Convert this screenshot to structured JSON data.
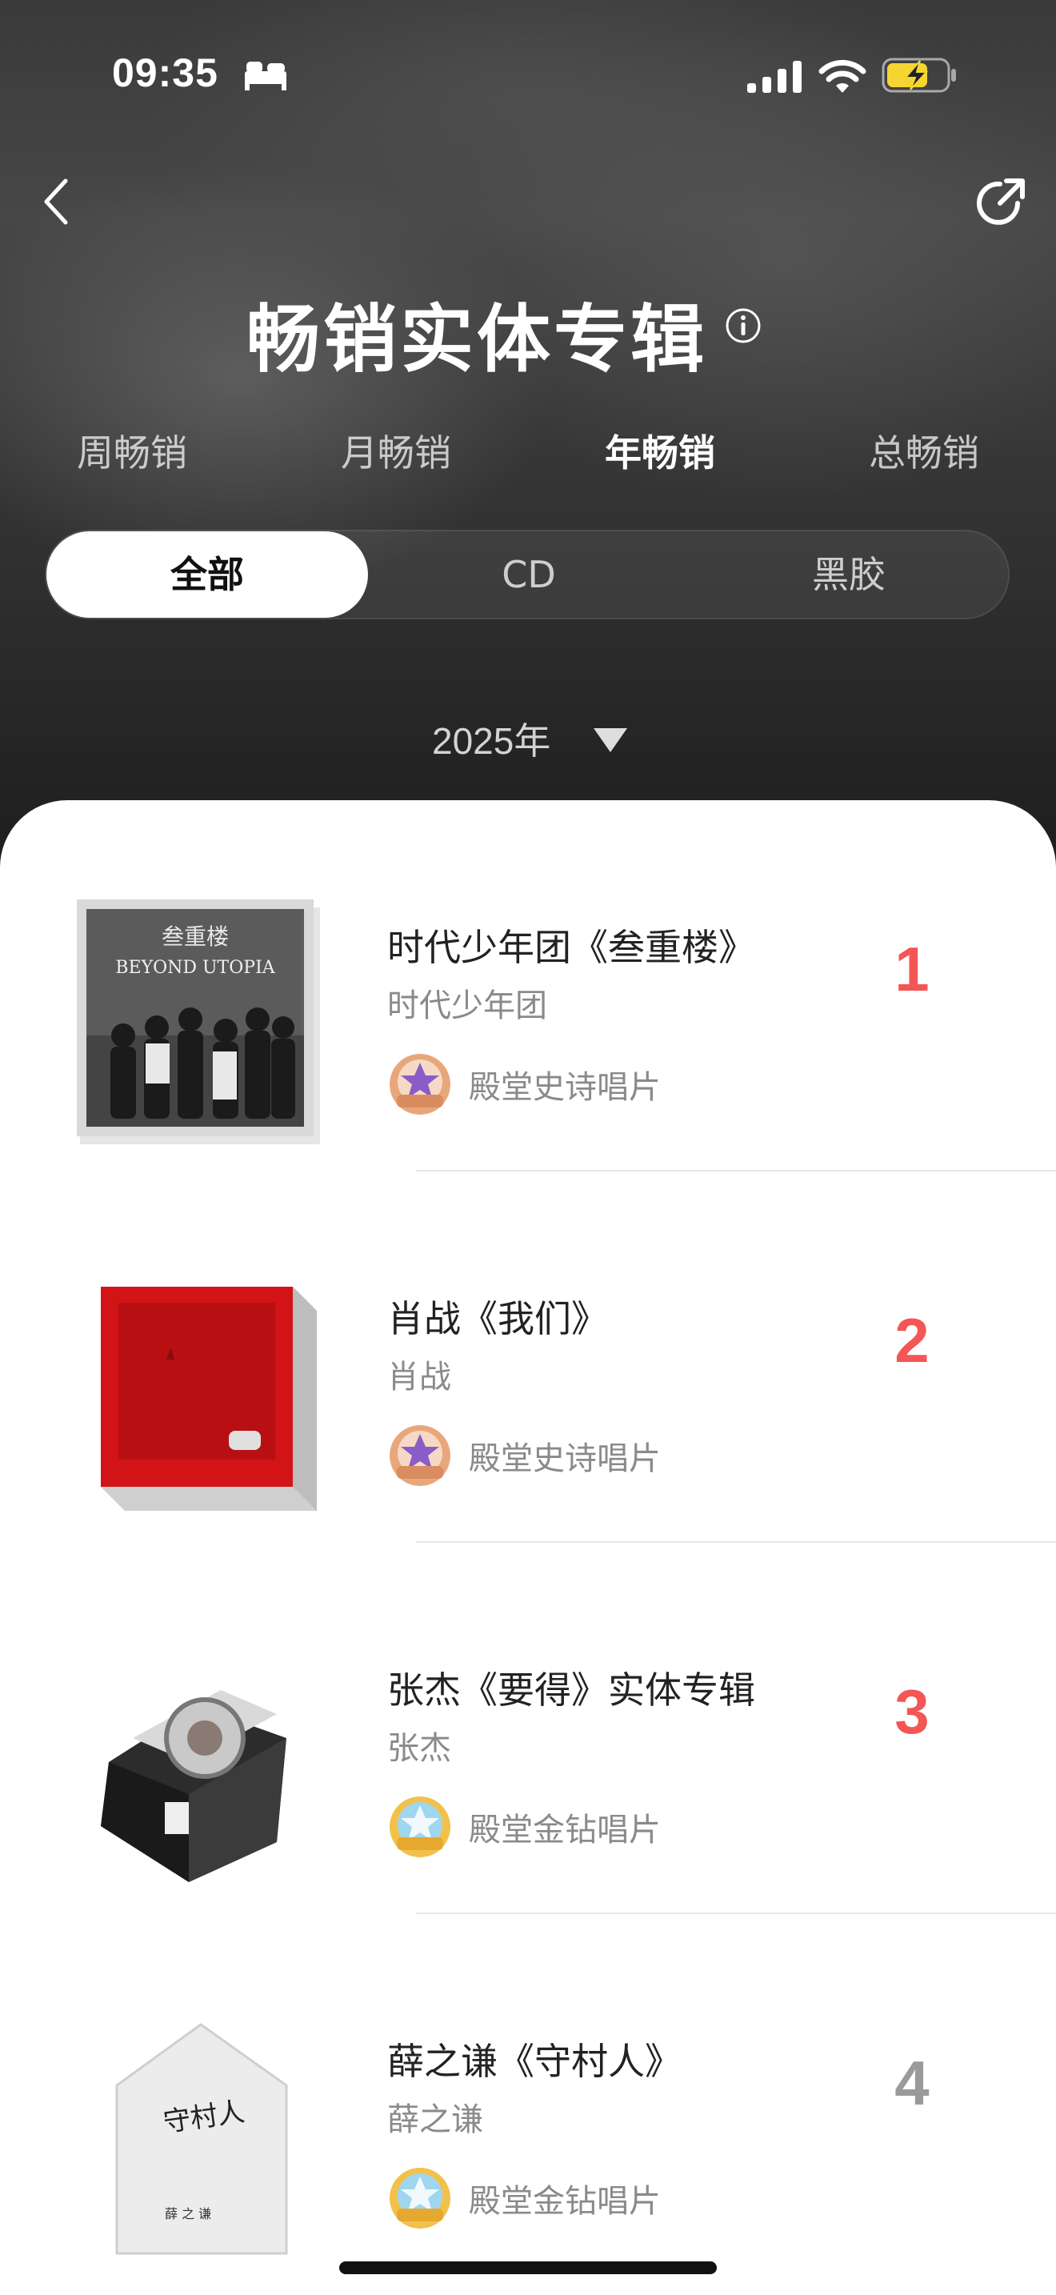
{
  "status_bar": {
    "time": "09:35"
  },
  "header": {
    "title": "畅销实体专辑"
  },
  "period_tabs": [
    {
      "label": "周畅销",
      "active": false
    },
    {
      "label": "月畅销",
      "active": false
    },
    {
      "label": "年畅销",
      "active": true
    },
    {
      "label": "总畅销",
      "active": false
    }
  ],
  "format_tabs": [
    {
      "label": "全部",
      "active": true
    },
    {
      "label": "CD",
      "active": false
    },
    {
      "label": "黑胶",
      "active": false
    }
  ],
  "year_filter": {
    "value": "2025年"
  },
  "colors": {
    "rank_top": "#f45555",
    "rank_other": "#9a9a9a",
    "battery": "#f5d531"
  },
  "albums": [
    {
      "rank": "1",
      "title": "时代少年团《叁重楼》",
      "artist": "时代少年团",
      "badge": "殿堂史诗唱片",
      "badge_type": "epic",
      "cover_text": "叁重楼",
      "cover_subtext": "BEYOND UTOPIA"
    },
    {
      "rank": "2",
      "title": "肖战《我们》",
      "artist": "肖战",
      "badge": "殿堂史诗唱片",
      "badge_type": "epic"
    },
    {
      "rank": "3",
      "title": "张杰《要得》实体专辑",
      "artist": "张杰",
      "badge": "殿堂金钻唱片",
      "badge_type": "diamond"
    },
    {
      "rank": "4",
      "title": "薛之谦《守村人》",
      "artist": "薛之谦",
      "badge": "殿堂金钻唱片",
      "badge_type": "diamond",
      "cover_text": "守村人",
      "cover_subtext": "薛 之 谦"
    }
  ]
}
